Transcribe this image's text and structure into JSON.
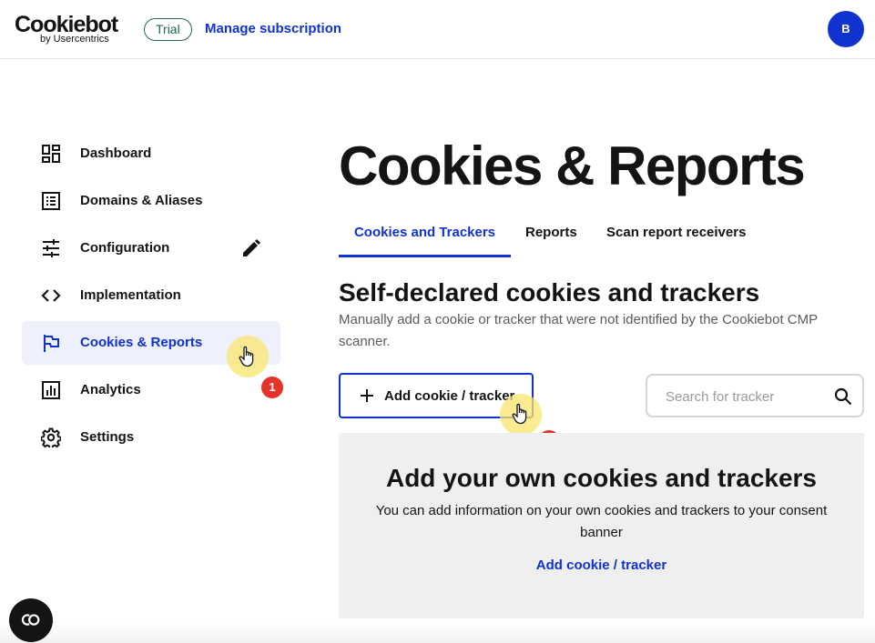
{
  "header": {
    "logo_main": "Cookiebot",
    "logo_sub": "by Usercentrics",
    "trial_badge": "Trial",
    "manage_link": "Manage subscription",
    "avatar_initial": "B"
  },
  "sidebar": {
    "items": [
      {
        "label": "Dashboard",
        "icon": "dashboard-icon"
      },
      {
        "label": "Domains & Aliases",
        "icon": "list-icon"
      },
      {
        "label": "Configuration",
        "icon": "sliders-icon"
      },
      {
        "label": "Implementation",
        "icon": "code-icon"
      },
      {
        "label": "Cookies & Reports",
        "icon": "flag-icon",
        "active": true
      },
      {
        "label": "Analytics",
        "icon": "chart-icon"
      },
      {
        "label": "Settings",
        "icon": "gear-icon"
      }
    ]
  },
  "steps": {
    "step1": "1",
    "step2": "2"
  },
  "main": {
    "title": "Cookies & Reports",
    "tabs": [
      {
        "label": "Cookies and Trackers",
        "active": true
      },
      {
        "label": "Reports"
      },
      {
        "label": "Scan report receivers"
      }
    ],
    "section_title": "Self-declared cookies and trackers",
    "section_desc": "Manually add a cookie or tracker that were not identified by the Cookiebot CMP scanner.",
    "add_button": "Add cookie / tracker",
    "search_placeholder": "Search for tracker",
    "empty_title": "Add your own cookies and trackers",
    "empty_desc": "You can add information on your own cookies and trackers to your consent banner",
    "empty_link": "Add cookie / tracker"
  },
  "colors": {
    "accent": "#1032cf",
    "trial_green": "#1f6a4a",
    "step_badge": "#e5332a",
    "hotspot": "#fae66e"
  }
}
